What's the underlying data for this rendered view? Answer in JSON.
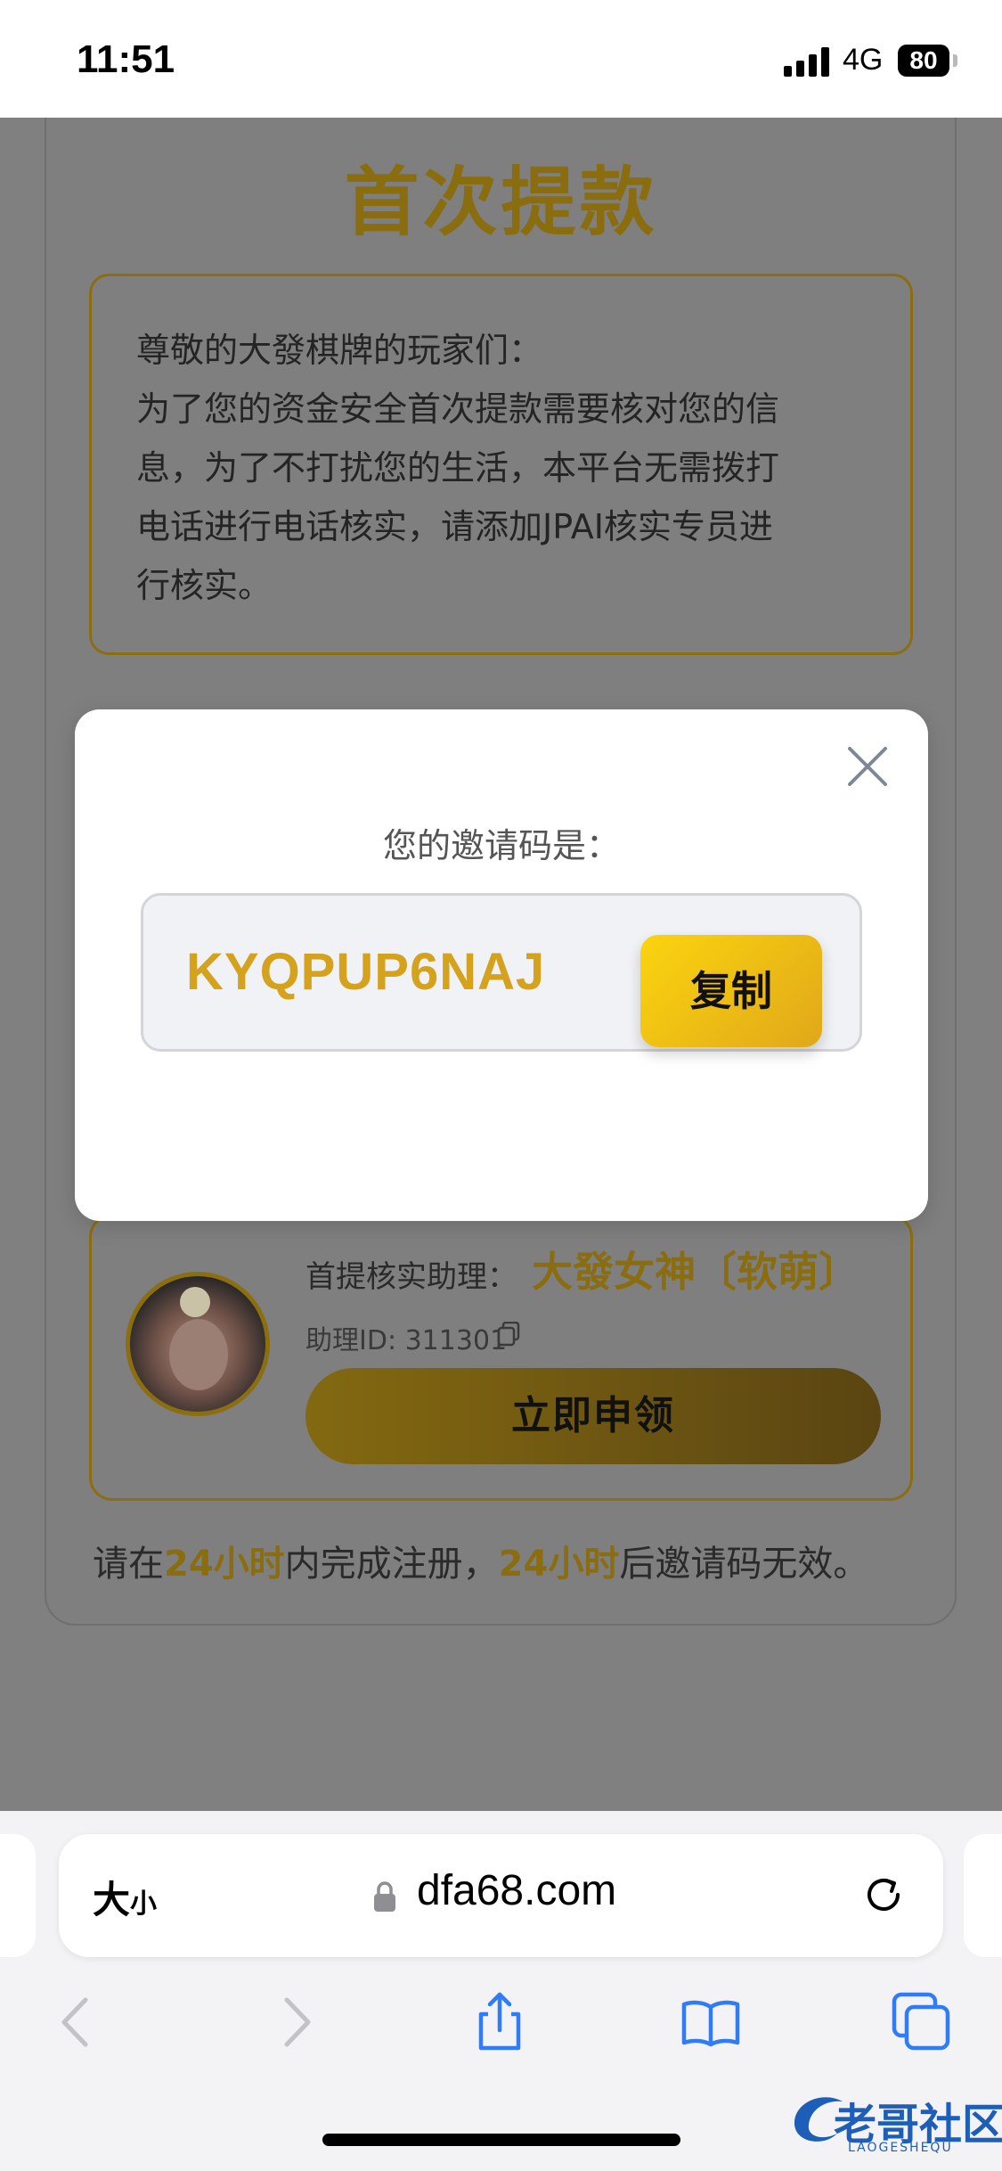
{
  "status_bar": {
    "time": "11:51",
    "network": "4G",
    "battery": "80"
  },
  "page": {
    "title": "首次提款",
    "notice_lines": [
      "尊敬的大發棋牌的玩家们：",
      "为了您的资金安全首次提款需要核对您的信",
      "息，为了不打扰您的生活，本平台无需拨打",
      "电话进行电话核实，请添加JPAI核实专员进",
      "行核实。"
    ],
    "assistant": {
      "label": "首提核实助理：",
      "name": "大發女神〔软萌〕",
      "id_label": "助理ID: 311301",
      "apply_label": "立即申领"
    },
    "footer": {
      "part1": "请在",
      "hl1": "24小时",
      "part2": "内完成注册，",
      "hl2": "24小时",
      "part3": "后邀请码无效。"
    }
  },
  "modal": {
    "title": "您的邀请码是：",
    "code": "KYQPUP6NAJ",
    "copy_label": "复制"
  },
  "browser": {
    "text_size_label": "大",
    "text_size_small": "小",
    "url": "dfa68.com"
  },
  "watermark": {
    "text": "老哥社区",
    "sub": "LAOGESHEQU"
  },
  "colors": {
    "accent_gold": "#d5a21e",
    "copy_button": "#fbd40f"
  }
}
